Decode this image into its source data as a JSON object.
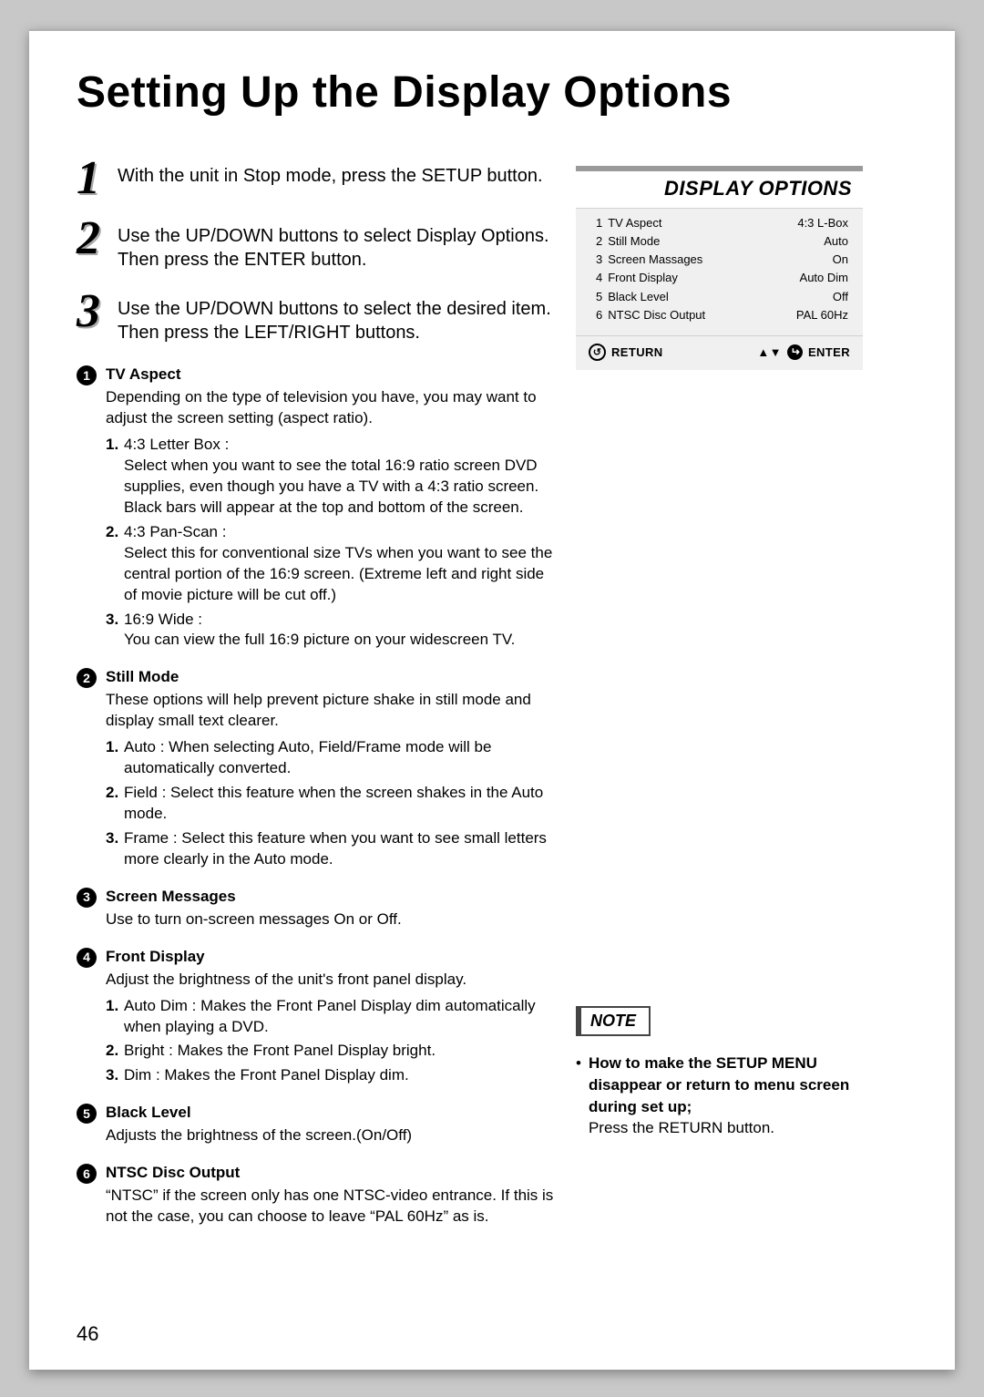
{
  "page": {
    "title": "Setting Up the Display Options",
    "page_number": "46"
  },
  "steps": [
    {
      "n": "1",
      "text": "With the unit in Stop mode, press the SETUP button."
    },
    {
      "n": "2",
      "text": "Use the UP/DOWN buttons to select Display Options. Then press the ENTER button."
    },
    {
      "n": "3",
      "text": "Use the UP/DOWN buttons to select the desired item. Then press the LEFT/RIGHT buttons."
    }
  ],
  "details": [
    {
      "num": "1",
      "title": "TV Aspect",
      "text": "Depending on the type of television you have, you may want to adjust the screen setting (aspect ratio).",
      "subs": [
        {
          "n": "1.",
          "t": "4:3 Letter Box :\nSelect when you want to see the total 16:9 ratio screen DVD supplies, even though you have a TV with a 4:3 ratio screen. Black bars will appear at the top and bottom of the screen."
        },
        {
          "n": "2.",
          "t": "4:3 Pan-Scan :\nSelect this for conventional size TVs when you want to see the central portion of the 16:9 screen. (Extreme left and right side of movie picture will be cut off.)"
        },
        {
          "n": "3.",
          "t": "16:9 Wide :\nYou can view the full 16:9 picture on your widescreen TV."
        }
      ]
    },
    {
      "num": "2",
      "title": "Still Mode",
      "text": "These options will help prevent picture shake in still mode and display small text clearer.",
      "subs": [
        {
          "n": "1.",
          "t": "Auto : When selecting Auto, Field/Frame mode will be automatically converted."
        },
        {
          "n": "2.",
          "t": "Field : Select this feature when the screen shakes in the Auto mode."
        },
        {
          "n": "3.",
          "t": "Frame : Select this feature when you want to see small letters more clearly in the Auto mode."
        }
      ]
    },
    {
      "num": "3",
      "title": "Screen Messages",
      "text": "Use to turn on-screen messages On or Off.",
      "subs": []
    },
    {
      "num": "4",
      "title": "Front Display",
      "text": "Adjust the brightness of the unit's front panel display.",
      "subs": [
        {
          "n": "1.",
          "t": "Auto Dim : Makes the Front Panel Display dim automatically when playing a DVD."
        },
        {
          "n": "2.",
          "t": "Bright : Makes the Front Panel Display bright."
        },
        {
          "n": "3.",
          "t": "Dim : Makes the Front Panel Display dim."
        }
      ]
    },
    {
      "num": "5",
      "title": "Black Level",
      "text": "Adjusts the brightness of the screen.(On/Off)",
      "subs": []
    },
    {
      "num": "6",
      "title": "NTSC Disc Output",
      "text": "“NTSC” if the screen only has one NTSC-video entrance. If this is not the case, you can choose to leave “PAL 60Hz” as is.",
      "subs": []
    }
  ],
  "menu": {
    "title": "DISPLAY OPTIONS",
    "rows": [
      {
        "n": "1",
        "label": "TV Aspect",
        "value": "4:3   L-Box"
      },
      {
        "n": "2",
        "label": "Still Mode",
        "value": "Auto"
      },
      {
        "n": "3",
        "label": "Screen Massages",
        "value": "On"
      },
      {
        "n": "4",
        "label": "Front Display",
        "value": "Auto Dim"
      },
      {
        "n": "5",
        "label": "Black Level",
        "value": "Off"
      },
      {
        "n": "6",
        "label": "NTSC Disc Output",
        "value": "PAL 60Hz"
      }
    ],
    "return_label": "RETURN",
    "enter_label": "ENTER"
  },
  "note": {
    "label": "NOTE",
    "bold_lines": "How to make the SETUP MENU disappear or return to menu screen during set up;",
    "tail": "Press the RETURN button."
  }
}
